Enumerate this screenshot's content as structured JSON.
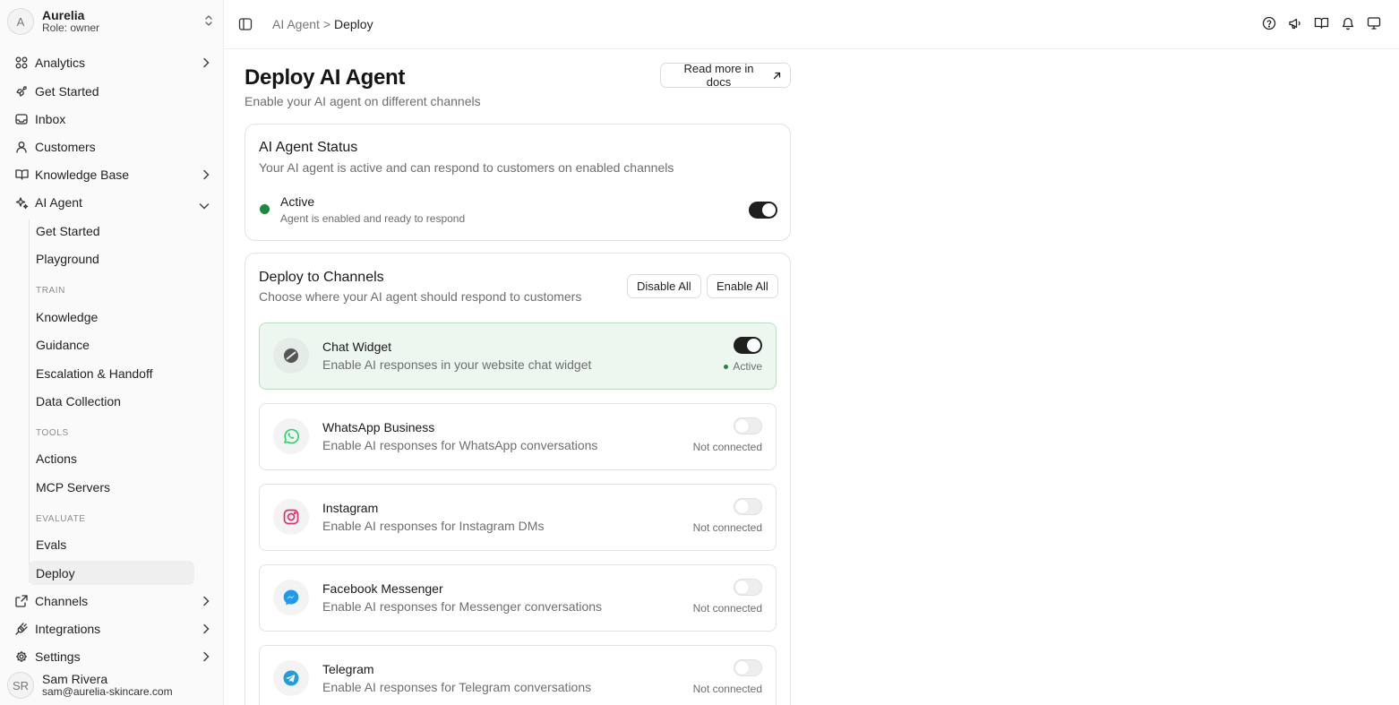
{
  "workspace": {
    "initial": "A",
    "name": "Aurelia",
    "role": "Role: owner"
  },
  "nav": {
    "analytics": "Analytics",
    "get_started": "Get Started",
    "inbox": "Inbox",
    "customers": "Customers",
    "knowledge_base": "Knowledge Base",
    "ai_agent": "AI Agent",
    "sub_get_started": "Get Started",
    "playground": "Playground",
    "train_label": "TRAIN",
    "knowledge": "Knowledge",
    "guidance": "Guidance",
    "escalation": "Escalation & Handoff",
    "data_collection": "Data Collection",
    "tools_label": "TOOLS",
    "actions": "Actions",
    "mcp_servers": "MCP Servers",
    "evaluate_label": "EVALUATE",
    "evals": "Evals",
    "deploy": "Deploy",
    "channels": "Channels",
    "integrations": "Integrations",
    "settings": "Settings"
  },
  "user": {
    "initials": "SR",
    "name": "Sam Rivera",
    "email": "sam@aurelia-skincare.com"
  },
  "breadcrumb": {
    "parent": "AI Agent >",
    "current": "Deploy"
  },
  "page": {
    "title": "Deploy AI Agent",
    "subtitle": "Enable your AI agent on different channels",
    "docs_button": "Read more in docs"
  },
  "status_card": {
    "title": "AI Agent Status",
    "subtitle": "Your AI agent is active and can respond to customers on enabled channels",
    "state": "Active",
    "description": "Agent is enabled and ready to respond",
    "enabled": true
  },
  "channels_card": {
    "title": "Deploy to Channels",
    "subtitle": "Choose where your AI agent should respond to customers",
    "disable_all": "Disable All",
    "enable_all": "Enable All"
  },
  "channels": [
    {
      "name": "Chat Widget",
      "description": "Enable AI responses in your website chat widget",
      "status": "Active",
      "enabled": true,
      "icon": "chat-widget-icon"
    },
    {
      "name": "WhatsApp Business",
      "description": "Enable AI responses for WhatsApp conversations",
      "status": "Not connected",
      "enabled": false,
      "icon": "whatsapp-icon"
    },
    {
      "name": "Instagram",
      "description": "Enable AI responses for Instagram DMs",
      "status": "Not connected",
      "enabled": false,
      "icon": "instagram-icon"
    },
    {
      "name": "Facebook Messenger",
      "description": "Enable AI responses for Messenger conversations",
      "status": "Not connected",
      "enabled": false,
      "icon": "messenger-icon"
    },
    {
      "name": "Telegram",
      "description": "Enable AI responses for Telegram conversations",
      "status": "Not connected",
      "enabled": false,
      "icon": "telegram-icon"
    }
  ],
  "colors": {
    "active_green": "#1c8a3c",
    "active_card_bg": "#eef6f0",
    "whatsapp": "#25d366",
    "instagram": "#e1306c",
    "messenger": "#1d9bf0",
    "telegram": "#229ed9"
  }
}
